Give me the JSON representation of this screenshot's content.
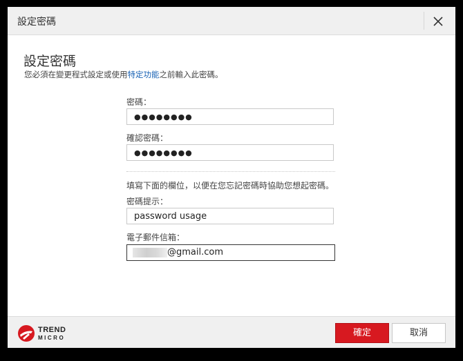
{
  "window": {
    "title": "設定密碼"
  },
  "header": {
    "heading": "設定密碼",
    "description_before": "您必須在變更程式設定或使用",
    "description_link": "特定功能",
    "description_after": "之前輸入此密碼。"
  },
  "form": {
    "password_label": "密碼：",
    "password_value": "●●●●●●●●",
    "confirm_label": "確認密碼：",
    "confirm_value": "●●●●●●●●",
    "info_text": "填寫下面的欄位，以便在您忘記密碼時協助您想起密碼。",
    "hint_label": "密碼提示：",
    "hint_value": "password usage",
    "email_label": "電子郵件信箱：",
    "email_visible_suffix": "@gmail.com"
  },
  "footer": {
    "logo_line1": "TREND",
    "logo_line2": "MICRO",
    "ok_label": "確定",
    "cancel_label": "取消"
  },
  "colors": {
    "accent": "#d71920",
    "link": "#1a63b5"
  }
}
